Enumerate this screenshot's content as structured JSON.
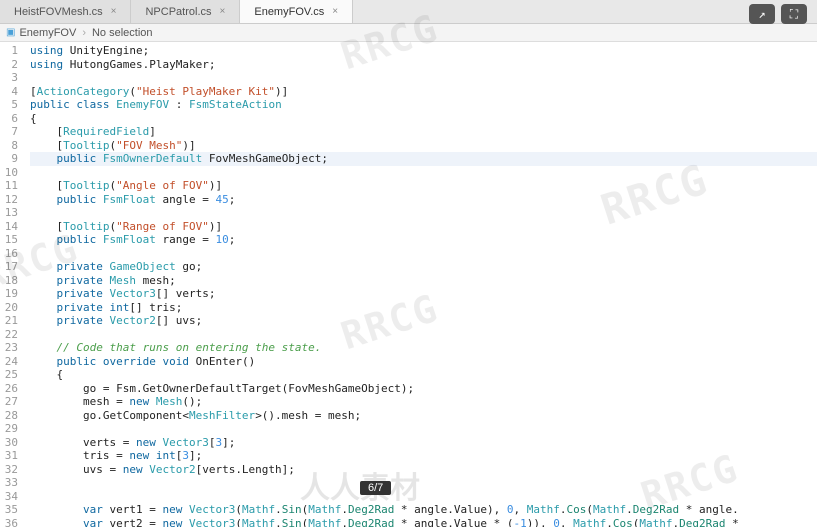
{
  "tabs": [
    {
      "label": "HeistFOVMesh.cs",
      "active": false
    },
    {
      "label": "NPCPatrol.cs",
      "active": false
    },
    {
      "label": "EnemyFOV.cs",
      "active": true
    }
  ],
  "breadcrumb": {
    "root": "EnemyFOV",
    "sep": "›",
    "current": "No selection"
  },
  "buttons": {
    "share": "↗",
    "fullscreen": "⛶"
  },
  "page_badge": "6/7",
  "watermarks": {
    "en": "RRCG",
    "cn": "人人素材"
  },
  "code": {
    "lines": [
      {
        "n": 1,
        "html": "<span class='kw'>using</span> UnityEngine;"
      },
      {
        "n": 2,
        "html": "<span class='kw'>using</span> HutongGames.PlayMaker;"
      },
      {
        "n": 3,
        "html": ""
      },
      {
        "n": 4,
        "html": "[<span class='attr'>ActionCategory</span>(<span class='str'>\"Heist PlayMaker Kit\"</span>)]"
      },
      {
        "n": 5,
        "html": "<span class='kw'>public</span> <span class='kw'>class</span> <span class='type'>EnemyFOV</span> : <span class='type'>FsmStateAction</span>"
      },
      {
        "n": 6,
        "html": "{"
      },
      {
        "n": 7,
        "html": "    [<span class='attr'>RequiredField</span>]"
      },
      {
        "n": 8,
        "html": "    [<span class='attr'>Tooltip</span>(<span class='str'>\"FOV Mesh\"</span>)]"
      },
      {
        "n": 9,
        "hl": true,
        "html": "    <span class='kw'>public</span> <span class='type'>FsmOwnerDefault</span> FovMeshGameObject;"
      },
      {
        "n": 10,
        "html": ""
      },
      {
        "n": 11,
        "html": "    [<span class='attr'>Tooltip</span>(<span class='str'>\"Angle of FOV\"</span>)]"
      },
      {
        "n": 12,
        "html": "    <span class='kw'>public</span> <span class='type'>FsmFloat</span> angle = <span class='num'>45</span>;"
      },
      {
        "n": 13,
        "html": ""
      },
      {
        "n": 14,
        "html": "    [<span class='attr'>Tooltip</span>(<span class='str'>\"Range of FOV\"</span>)]"
      },
      {
        "n": 15,
        "html": "    <span class='kw'>public</span> <span class='type'>FsmFloat</span> range = <span class='num'>10</span>;"
      },
      {
        "n": 16,
        "html": ""
      },
      {
        "n": 17,
        "html": "    <span class='kw'>private</span> <span class='type'>GameObject</span> go;"
      },
      {
        "n": 18,
        "html": "    <span class='kw'>private</span> <span class='type'>Mesh</span> mesh;"
      },
      {
        "n": 19,
        "html": "    <span class='kw'>private</span> <span class='type'>Vector3</span>[] verts;"
      },
      {
        "n": 20,
        "html": "    <span class='kw'>private</span> <span class='kw'>int</span>[] tris;"
      },
      {
        "n": 21,
        "html": "    <span class='kw'>private</span> <span class='type'>Vector2</span>[] uvs;"
      },
      {
        "n": 22,
        "html": ""
      },
      {
        "n": 23,
        "html": "    <span class='comment'>// Code that runs on entering the state.</span>"
      },
      {
        "n": 24,
        "html": "    <span class='kw'>public</span> <span class='kw'>override</span> <span class='kw'>void</span> <span class='method'>OnEnter</span>()"
      },
      {
        "n": 25,
        "html": "    {"
      },
      {
        "n": 26,
        "html": "        go = Fsm.GetOwnerDefaultTarget(FovMeshGameObject);"
      },
      {
        "n": 27,
        "html": "        mesh = <span class='kw'>new</span> <span class='type'>Mesh</span>();"
      },
      {
        "n": 28,
        "html": "        go.GetComponent&lt;<span class='type'>MeshFilter</span>&gt;().mesh = mesh;"
      },
      {
        "n": 29,
        "html": ""
      },
      {
        "n": 30,
        "html": "        verts = <span class='kw'>new</span> <span class='type'>Vector3</span>[<span class='num'>3</span>];"
      },
      {
        "n": 31,
        "html": "        tris = <span class='kw'>new</span> <span class='kw'>int</span>[<span class='num'>3</span>];"
      },
      {
        "n": 32,
        "html": "        uvs = <span class='kw'>new</span> <span class='type'>Vector2</span>[verts.Length];"
      },
      {
        "n": 33,
        "html": ""
      },
      {
        "n": 34,
        "html": ""
      },
      {
        "n": 35,
        "html": "        <span class='kw'>var</span> vert1 = <span class='kw'>new</span> <span class='type'>Vector3</span>(<span class='type'>Mathf</span>.<span class='prop'>Sin</span>(<span class='type'>Mathf</span>.<span class='prop'>Deg2Rad</span> * angle.Value), <span class='num'>0</span>, <span class='type'>Mathf</span>.<span class='prop'>Cos</span>(<span class='type'>Mathf</span>.<span class='prop'>Deg2Rad</span> * angle."
      },
      {
        "n": 36,
        "html": "        <span class='kw'>var</span> vert2 = <span class='kw'>new</span> <span class='type'>Vector3</span>(<span class='type'>Mathf</span>.<span class='prop'>Sin</span>(<span class='type'>Mathf</span>.<span class='prop'>Deg2Rad</span> * angle.Value * (<span class='num'>-1</span>)), <span class='num'>0</span>, <span class='type'>Mathf</span>.<span class='prop'>Cos</span>(<span class='type'>Mathf</span>.<span class='prop'>Deg2Rad</span> *"
      }
    ]
  }
}
